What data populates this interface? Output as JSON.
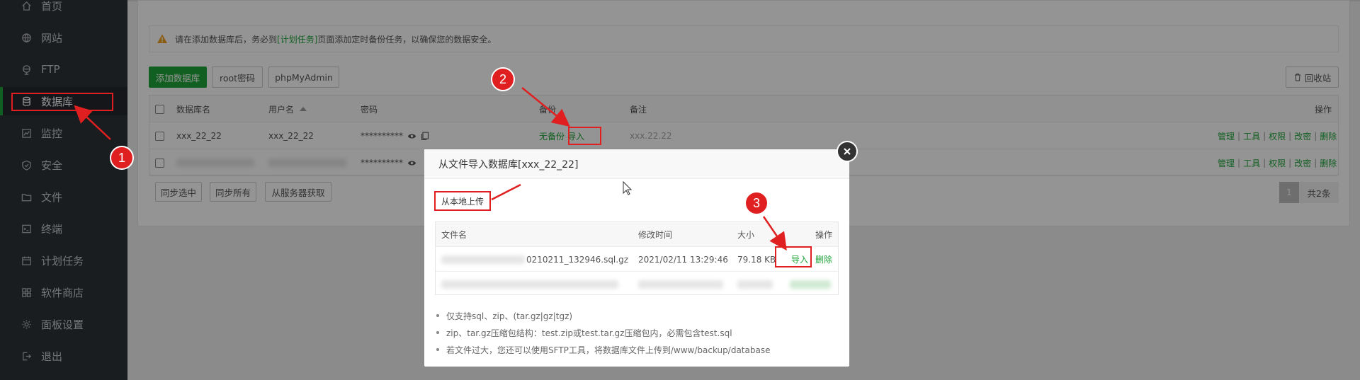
{
  "sidebar": {
    "items": [
      {
        "label": "首页",
        "icon": "home-icon"
      },
      {
        "label": "网站",
        "icon": "globe-icon"
      },
      {
        "label": "FTP",
        "icon": "ftp-icon"
      },
      {
        "label": "数据库",
        "icon": "database-icon",
        "active": true
      },
      {
        "label": "监控",
        "icon": "monitor-icon"
      },
      {
        "label": "安全",
        "icon": "shield-icon"
      },
      {
        "label": "文件",
        "icon": "folder-icon"
      },
      {
        "label": "终端",
        "icon": "terminal-icon"
      },
      {
        "label": "计划任务",
        "icon": "calendar-icon"
      },
      {
        "label": "软件商店",
        "icon": "grid-icon"
      },
      {
        "label": "面板设置",
        "icon": "gear-icon"
      },
      {
        "label": "退出",
        "icon": "logout-icon"
      }
    ]
  },
  "tips": {
    "text_before": "请在添加数据库后，务必到",
    "link": "[计划任务]",
    "text_after": "页面添加定时备份任务，以确保您的数据安全。"
  },
  "toolbar": {
    "add_db": "添加数据库",
    "root_pwd": "root密码",
    "phpmyadmin": "phpMyAdmin",
    "recycle": "回收站"
  },
  "table": {
    "headers": {
      "name": "数据库名",
      "user": "用户名",
      "password": "密码",
      "backup": "备份",
      "note": "备注",
      "ops": "操作"
    },
    "rows": [
      {
        "name": "xxx_22_22",
        "user": "xxx_22_22",
        "password": "**********",
        "backup_status": "无备份",
        "import": "导入",
        "note": "xxx.22.22"
      },
      {
        "name": "",
        "user": "",
        "password": "**********",
        "backup_status": "",
        "import": "",
        "note": ""
      }
    ],
    "ops": [
      "管理",
      "工具",
      "权限",
      "改密",
      "删除"
    ]
  },
  "bottom_buttons": {
    "sync_selected": "同步选中",
    "sync_all": "同步所有",
    "fetch_server": "从服务器获取"
  },
  "pager": {
    "page": "1",
    "total": "共2条"
  },
  "modal": {
    "title": "从文件导入数据库[xxx_22_22]",
    "upload": "从本地上传",
    "headers": {
      "file": "文件名",
      "time": "修改时间",
      "size": "大小",
      "ops": "操作"
    },
    "rows": [
      {
        "file": "0210211_132946.sql.gz",
        "time": "2021/02/11 13:29:46",
        "size": "79.18 KB",
        "import": "导入",
        "delete": "删除"
      }
    ],
    "notes": [
      "仅支持sql、zip、(tar.gz|gz|tgz)",
      "zip、tar.gz压缩包结构：test.zip或test.tar.gz压缩包内，必需包含test.sql",
      "若文件过大，您还可以使用SFTP工具，将数据库文件上传到/www/backup/database"
    ]
  },
  "annotations": [
    "1",
    "2",
    "3"
  ],
  "colors": {
    "accent": "#20a53a",
    "annotation": "#e02020",
    "sidebar": "#2e3238"
  }
}
